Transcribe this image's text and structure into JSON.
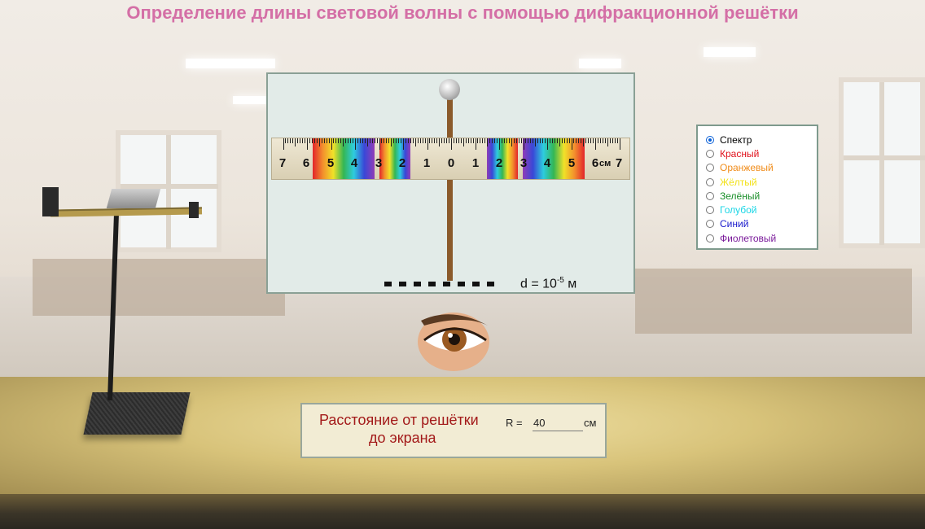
{
  "title": "Определение длины световой волны с помощью дифракционной решётки",
  "ruler": {
    "left_labels": [
      "7",
      "6",
      "5",
      "4",
      "3",
      "2",
      "1"
    ],
    "center_label": "0",
    "right_labels": [
      "1",
      "2",
      "3",
      "4",
      "5",
      "6"
    ],
    "end_label": "7",
    "unit": "см"
  },
  "grating": {
    "prefix": "d = 10",
    "exponent": "-5",
    "unit": " м"
  },
  "color_selector": {
    "selected": "Спектр",
    "options": [
      {
        "label": "Спектр",
        "color": "#000000"
      },
      {
        "label": "Красный",
        "color": "#e0101b"
      },
      {
        "label": "Оранжевый",
        "color": "#f08c1a"
      },
      {
        "label": "Жёлтый",
        "color": "#f2e21a"
      },
      {
        "label": "Зелёный",
        "color": "#1a8f2a"
      },
      {
        "label": "Голубой",
        "color": "#1ad6e6"
      },
      {
        "label": "Синий",
        "color": "#1a1acc"
      },
      {
        "label": "Фиолетовый",
        "color": "#7a1a9a"
      }
    ]
  },
  "distance": {
    "label_line1": "Расстояние от решётки",
    "label_line2": "до экрана",
    "input_label": "R =",
    "value": "40",
    "unit": "см"
  },
  "icons": [
    "eye-icon",
    "diffraction-stand",
    "grating-knob"
  ]
}
